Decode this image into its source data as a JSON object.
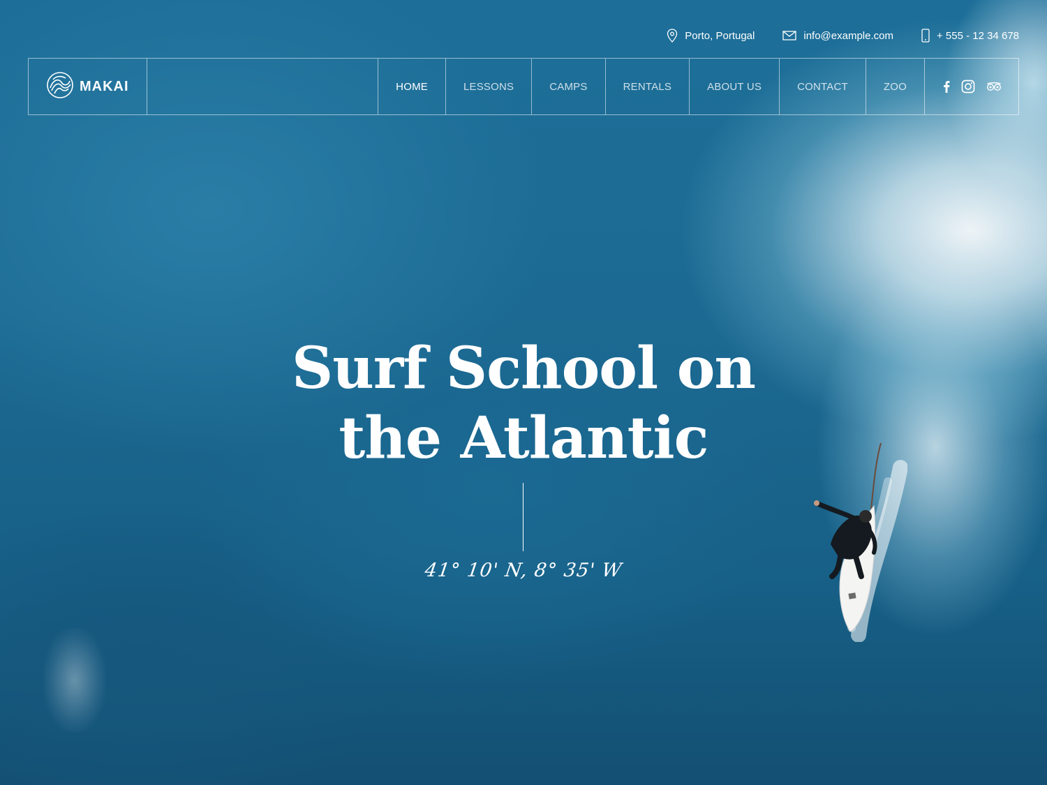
{
  "topbar": {
    "location": "Porto, Portugal",
    "email": "info@example.com",
    "phone": "+ 555 - 12 34 678"
  },
  "header": {
    "brand": "MAKAI",
    "nav": [
      {
        "label": "HOME",
        "active": true
      },
      {
        "label": "LESSONS",
        "active": false
      },
      {
        "label": "CAMPS",
        "active": false
      },
      {
        "label": "RENTALS",
        "active": false
      },
      {
        "label": "ABOUT US",
        "active": false
      },
      {
        "label": "CONTACT",
        "active": false
      },
      {
        "label": "ZOO",
        "active": false
      }
    ],
    "social_icons": [
      "facebook-icon",
      "instagram-icon",
      "tripadvisor-icon"
    ]
  },
  "hero": {
    "title_line1": "Surf School on",
    "title_line2": "the Atlantic",
    "coordinates": "41° 10' N, 8° 35' W"
  },
  "colors": {
    "ocean": "#1f6f98",
    "text": "#ffffff"
  }
}
